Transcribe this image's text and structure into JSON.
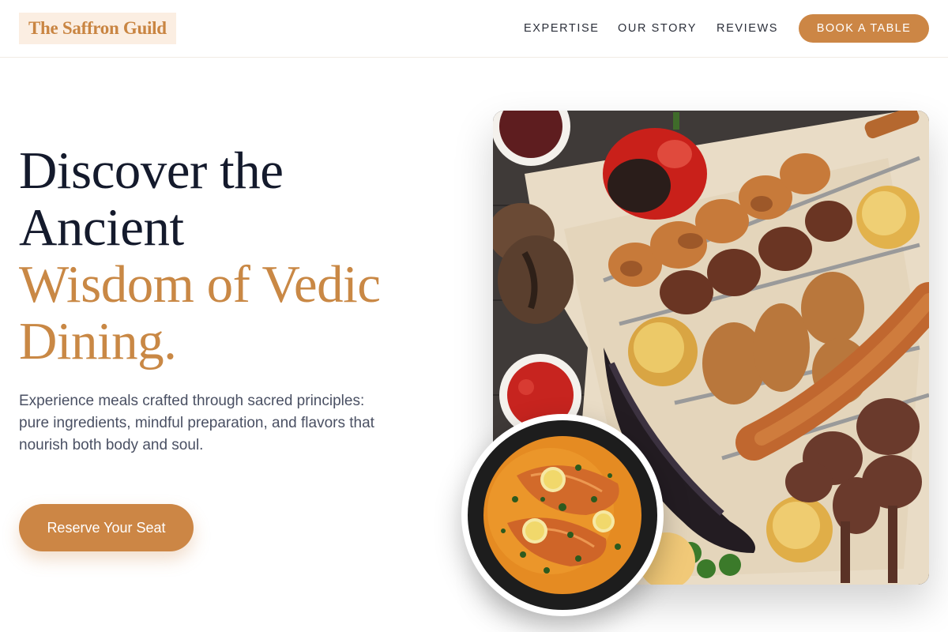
{
  "brand": {
    "name": "The Saffron Guild"
  },
  "nav": {
    "links": [
      "EXPERTISE",
      "OUR STORY",
      "REVIEWS"
    ],
    "cta": "BOOK A TABLE"
  },
  "hero": {
    "headline_line1": "Discover the",
    "headline_line2": "Ancient",
    "headline_accent_line1": "Wisdom of Vedic",
    "headline_accent_line2": "Dining.",
    "description": "Experience meals crafted through sacred principles: pure ingredients, mindful preparation, and flavors that nourish both body and soul.",
    "cta": "Reserve Your Seat"
  },
  "colors": {
    "accent": "#cc8645",
    "heading": "#141a2c",
    "body_text": "#4a5063",
    "logo_bg": "#fbeee2"
  },
  "images": {
    "main_photo": "grilled-meat-platter-image",
    "inset_photo": "fish-curry-bowl-image"
  }
}
